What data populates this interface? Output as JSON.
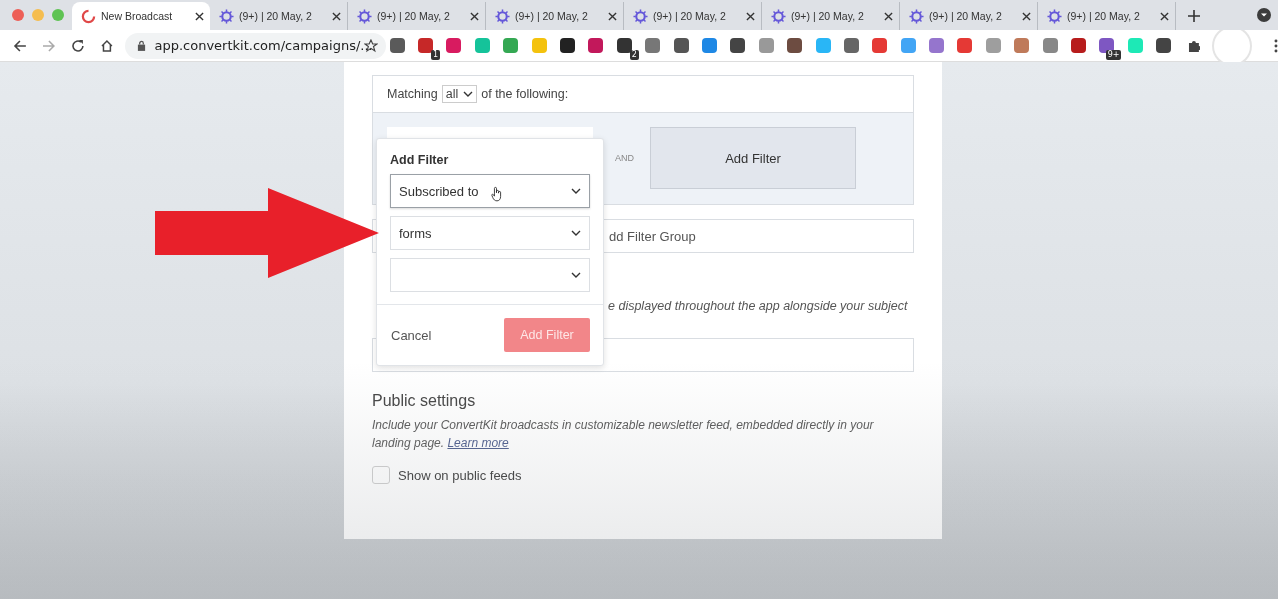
{
  "browser": {
    "tabs": [
      {
        "title": "New Broadcast",
        "selected": true
      },
      {
        "title": "(9+) | 20 May, 2",
        "selected": false
      },
      {
        "title": "(9+) | 20 May, 2",
        "selected": false
      },
      {
        "title": "(9+) | 20 May, 2",
        "selected": false
      },
      {
        "title": "(9+) | 20 May, 2",
        "selected": false
      },
      {
        "title": "(9+) | 20 May, 2",
        "selected": false
      },
      {
        "title": "(9+) | 20 May, 2",
        "selected": false
      },
      {
        "title": "(9+) | 20 May, 2",
        "selected": false
      }
    ],
    "url": "app.convertkit.com/campaigns/...",
    "extensions": [
      {
        "color": "#5a5a5a"
      },
      {
        "color": "#c62828",
        "badge": "1"
      },
      {
        "color": "#d81b60"
      },
      {
        "color": "#15c39a"
      },
      {
        "color": "#34a853"
      },
      {
        "color": "#f4c20d"
      },
      {
        "color": "#222222"
      },
      {
        "color": "#c2185b"
      },
      {
        "color": "#333333",
        "badge": "2"
      },
      {
        "color": "#777777"
      },
      {
        "color": "#555555"
      },
      {
        "color": "#1e88e5"
      },
      {
        "color": "#444444"
      },
      {
        "color": "#999999"
      },
      {
        "color": "#6d4c41"
      },
      {
        "color": "#29b6f6"
      },
      {
        "color": "#666666"
      },
      {
        "color": "#e53935"
      },
      {
        "color": "#42a5f5"
      },
      {
        "color": "#9575cd"
      },
      {
        "color": "#e53935"
      },
      {
        "color": "#9e9e9e"
      },
      {
        "color": "#bf7a5a"
      },
      {
        "color": "#888888"
      },
      {
        "color": "#b71c1c"
      },
      {
        "color": "#7e57c2",
        "badge": "9+"
      },
      {
        "color": "#1de9b6"
      },
      {
        "color": "#444444"
      }
    ]
  },
  "filter": {
    "matching_label": "Matching",
    "matching_value": "all",
    "following_label": "of the following:",
    "and_label": "AND",
    "add_filter_button": "Add Filter",
    "add_group_text": "dd Filter Group"
  },
  "popover": {
    "title": "Add Filter",
    "selects": [
      {
        "value": "Subscribed to",
        "focused": true
      },
      {
        "value": "forms",
        "focused": false
      },
      {
        "focused": false
      }
    ],
    "cancel": "Cancel",
    "submit": {
      "label": "Add Filter",
      "disabled": true
    }
  },
  "preview_text_fragment": "e displayed throughout the app alongside your subject",
  "public": {
    "heading": "Public settings",
    "description": "Include your ConvertKit broadcasts in customizable newsletter feed, embedded directly in your landing page.",
    "link": "Learn more",
    "checkbox": {
      "label": "Show on public feeds",
      "checked": false
    }
  }
}
